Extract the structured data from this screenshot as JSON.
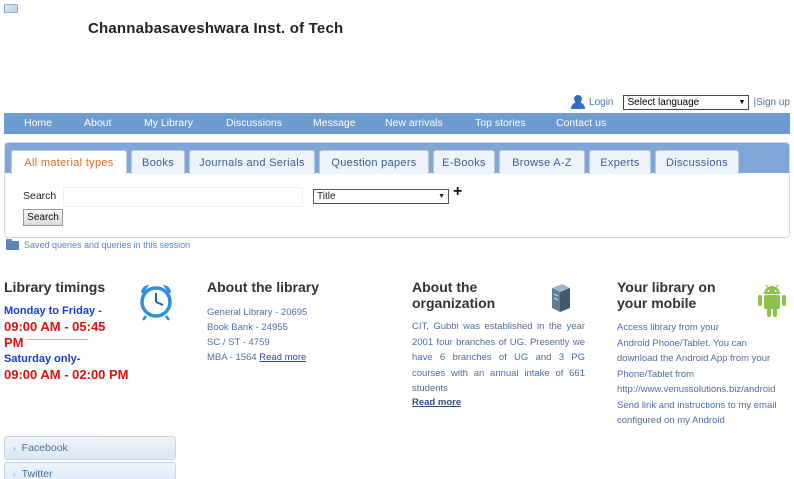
{
  "header": {
    "broken_image_alt": "",
    "site_title": "Channabasaveshwara Inst. of Tech"
  },
  "topbar": {
    "login_label": "Login",
    "language_select": "Select language",
    "signup_label": "|Sign up"
  },
  "nav": {
    "items": [
      "Home",
      "About",
      "My Library",
      "Discussions",
      "Message",
      "New arrivals",
      "Top stories",
      "Contact us"
    ]
  },
  "search": {
    "tabs": [
      "All material types",
      "Books",
      "Journals and Serials",
      "Question papers",
      "E-Books",
      "Browse A-Z",
      "Experts",
      "Discussions"
    ],
    "active_tab": "All material types",
    "search_label": "Search",
    "search_value": "",
    "field_select": "Title",
    "plus_label": "+",
    "search_button": "Search",
    "saved_queries": "Saved queries and queries in this session"
  },
  "timings": {
    "title": "Library timings",
    "weekday_label": "Monday to Friday -",
    "weekday_hours_1": "09:00 AM - 05:45",
    "weekday_hours_2": "PM",
    "weekday_dashes": "-------------------------------",
    "saturday_label": "Saturday only-",
    "saturday_hours": "09:00 AM - 02:00 PM"
  },
  "about_library": {
    "title": "About the library",
    "lines": [
      "General Library - 20695",
      "Book Bank - 24955",
      "SC / ST - 4759"
    ],
    "mba_line": "MBA - 1564",
    "read_more": "Read more"
  },
  "about_org": {
    "title_1": "About the",
    "title_2": "organization",
    "text": "CIT, Gubbi was established in the year 2001 four branches of UG. Presently we have 6 branches of UG and 3 PG courses with an annual intake of 661 students",
    "read_more": "Read more"
  },
  "mobile": {
    "title_1": "Your library on",
    "title_2": "your mobile",
    "lines": [
      "Access library from your",
      "Android Phone/Tablet. You can",
      "download the Android App from your",
      "Phone/Tablet from",
      "http://www.venussolutions.biz/android",
      "Send link and instructions to my email",
      "configured on my Android"
    ]
  },
  "social": {
    "facebook": "Facebook",
    "twitter": "Twitter"
  },
  "colors": {
    "nav_bg": "#6b9bd1",
    "tab_active_text": "#e06a20",
    "timing_red": "#e01010",
    "timing_blue": "#1540d0",
    "link_blue": "#4b6fa6"
  }
}
